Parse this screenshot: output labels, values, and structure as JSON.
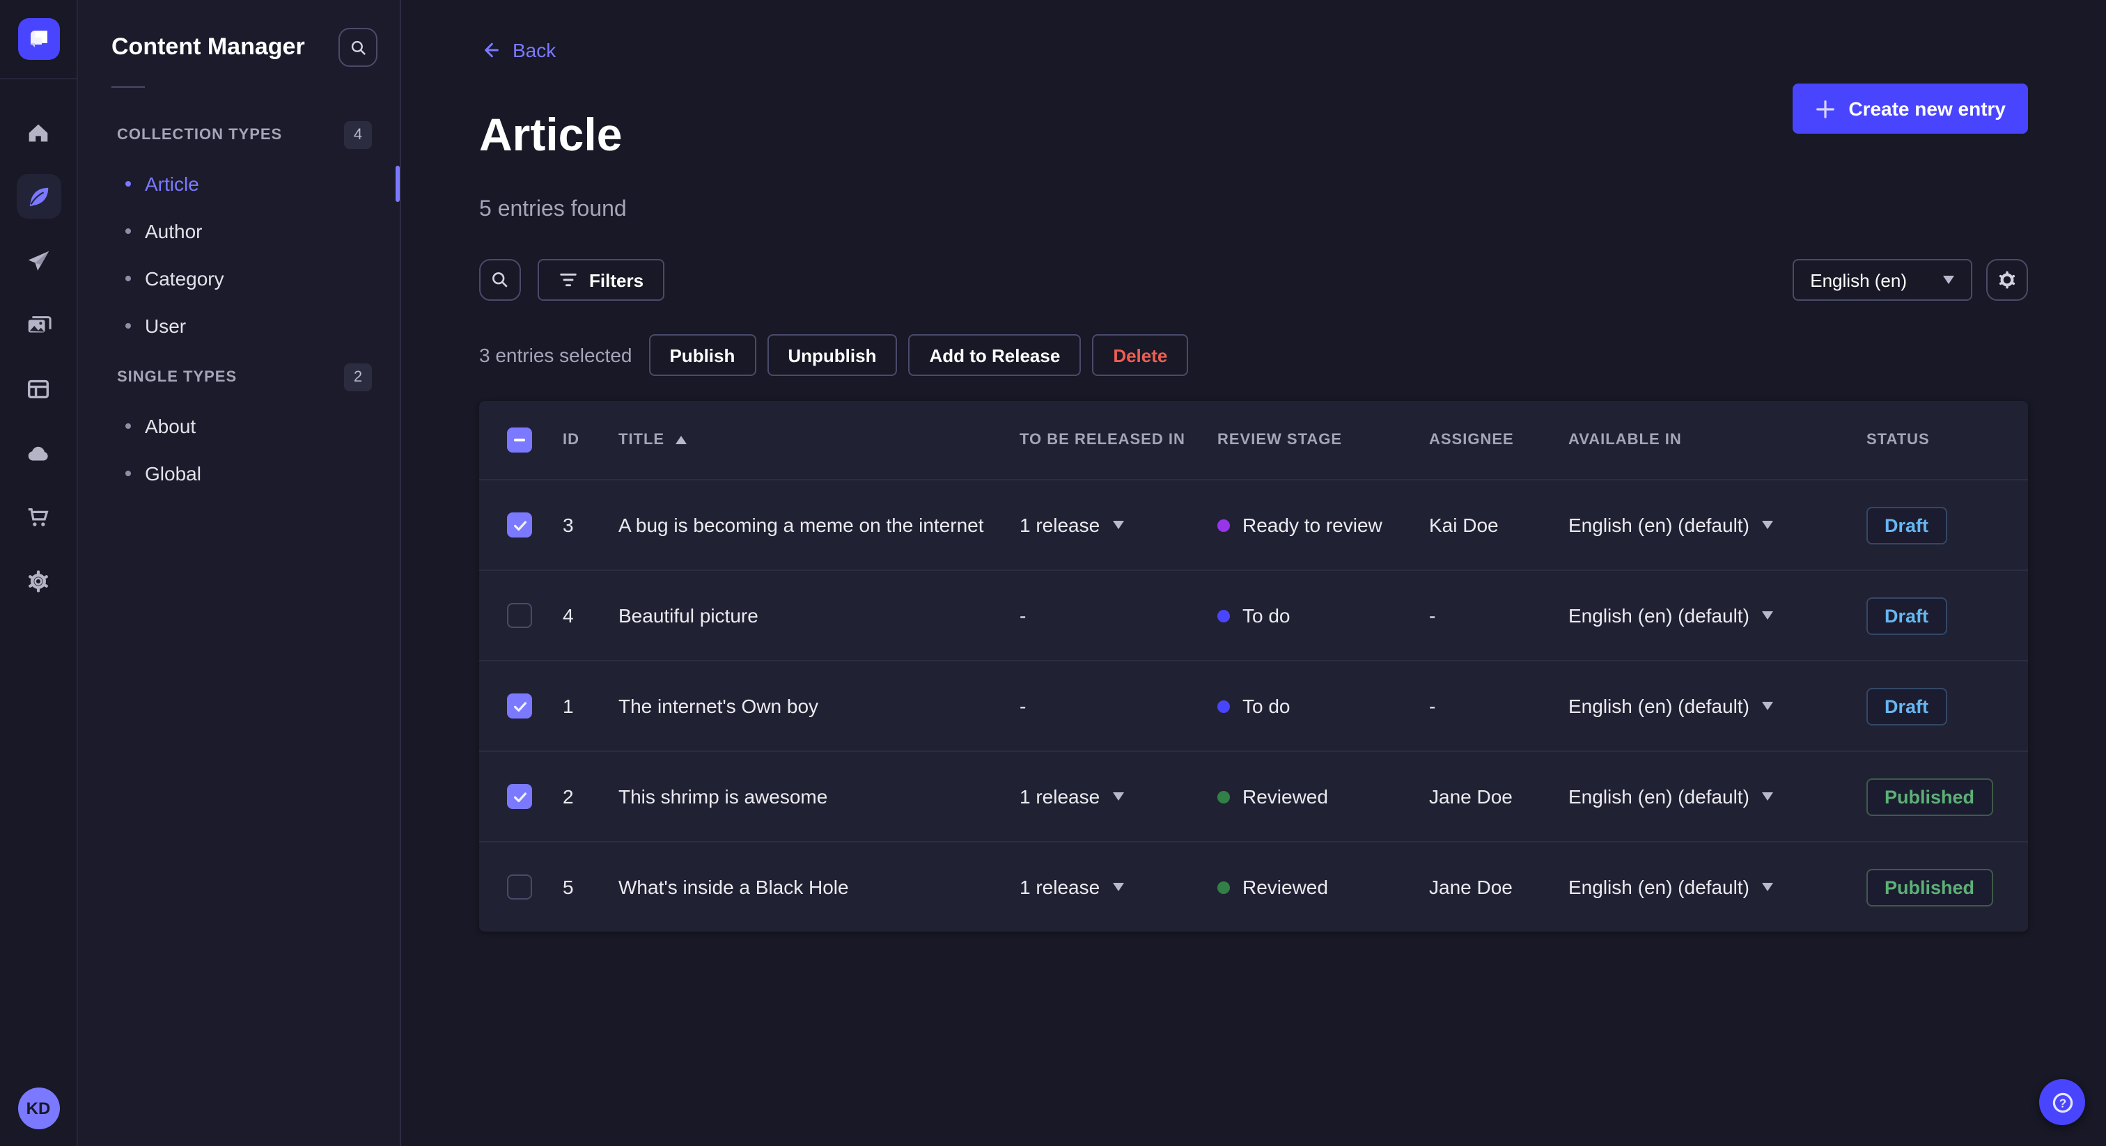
{
  "colors": {
    "accent": "#7b79ff",
    "primary": "#4945ff",
    "danger": "#ee5e52",
    "draft": "#66b7f1",
    "published": "#5cb176",
    "stage_ready": "#9736e8",
    "stage_todo": "#4945ff",
    "stage_reviewed": "#328048"
  },
  "rail": {
    "icons": [
      "strapi-logo",
      "home-icon",
      "content-manager-icon",
      "releases-icon",
      "media-library-icon",
      "content-type-builder-icon",
      "cloud-icon",
      "marketplace-icon",
      "settings-icon"
    ],
    "active_icon": "content-manager-icon",
    "avatar_initials": "KD"
  },
  "subnav": {
    "title": "Content Manager",
    "search_icon": "search-icon",
    "sections": [
      {
        "label": "COLLECTION TYPES",
        "count": "4",
        "items": [
          {
            "label": "Article",
            "active": true
          },
          {
            "label": "Author",
            "active": false
          },
          {
            "label": "Category",
            "active": false
          },
          {
            "label": "User",
            "active": false
          }
        ]
      },
      {
        "label": "SINGLE TYPES",
        "count": "2",
        "items": [
          {
            "label": "About",
            "active": false
          },
          {
            "label": "Global",
            "active": false
          }
        ]
      }
    ]
  },
  "header": {
    "back_label": "Back",
    "title": "Article",
    "subtitle": "5 entries found",
    "create_button": "Create new entry"
  },
  "toolbar": {
    "search_icon": "search-icon",
    "filters_label": "Filters",
    "locale_value": "English (en)",
    "settings_icon": "gear-icon"
  },
  "bulkbar": {
    "selected_text": "3 entries selected",
    "buttons": [
      {
        "label": "Publish",
        "danger": false
      },
      {
        "label": "Unpublish",
        "danger": false
      },
      {
        "label": "Add to Release",
        "danger": false
      },
      {
        "label": "Delete",
        "danger": true
      }
    ]
  },
  "table": {
    "headers": {
      "id": "ID",
      "title": "TITLE",
      "release": "TO BE RELEASED IN",
      "stage": "REVIEW STAGE",
      "assignee": "ASSIGNEE",
      "locale": "AVAILABLE IN",
      "status": "STATUS"
    },
    "sort_column": "TITLE",
    "sort_direction": "asc",
    "rows": [
      {
        "checked": true,
        "id": "3",
        "title": "A bug is becoming a meme on the internet",
        "release": "1 release",
        "stage": "Ready to review",
        "stage_color": "#9736e8",
        "assignee": "Kai Doe",
        "locale": "English (en) (default)",
        "status": "Draft"
      },
      {
        "checked": false,
        "id": "4",
        "title": "Beautiful picture",
        "release": "-",
        "stage": "To do",
        "stage_color": "#4945ff",
        "assignee": "-",
        "locale": "English (en) (default)",
        "status": "Draft"
      },
      {
        "checked": true,
        "id": "1",
        "title": "The internet's Own boy",
        "release": "-",
        "stage": "To do",
        "stage_color": "#4945ff",
        "assignee": "-",
        "locale": "English (en) (default)",
        "status": "Draft"
      },
      {
        "checked": true,
        "id": "2",
        "title": "This shrimp is awesome",
        "release": "1 release",
        "stage": "Reviewed",
        "stage_color": "#328048",
        "assignee": "Jane Doe",
        "locale": "English (en) (default)",
        "status": "Published"
      },
      {
        "checked": false,
        "id": "5",
        "title": "What's inside a Black Hole",
        "release": "1 release",
        "stage": "Reviewed",
        "stage_color": "#328048",
        "assignee": "Jane Doe",
        "locale": "English (en) (default)",
        "status": "Published"
      }
    ]
  },
  "help": {
    "icon": "help-icon",
    "glyph": "?"
  }
}
